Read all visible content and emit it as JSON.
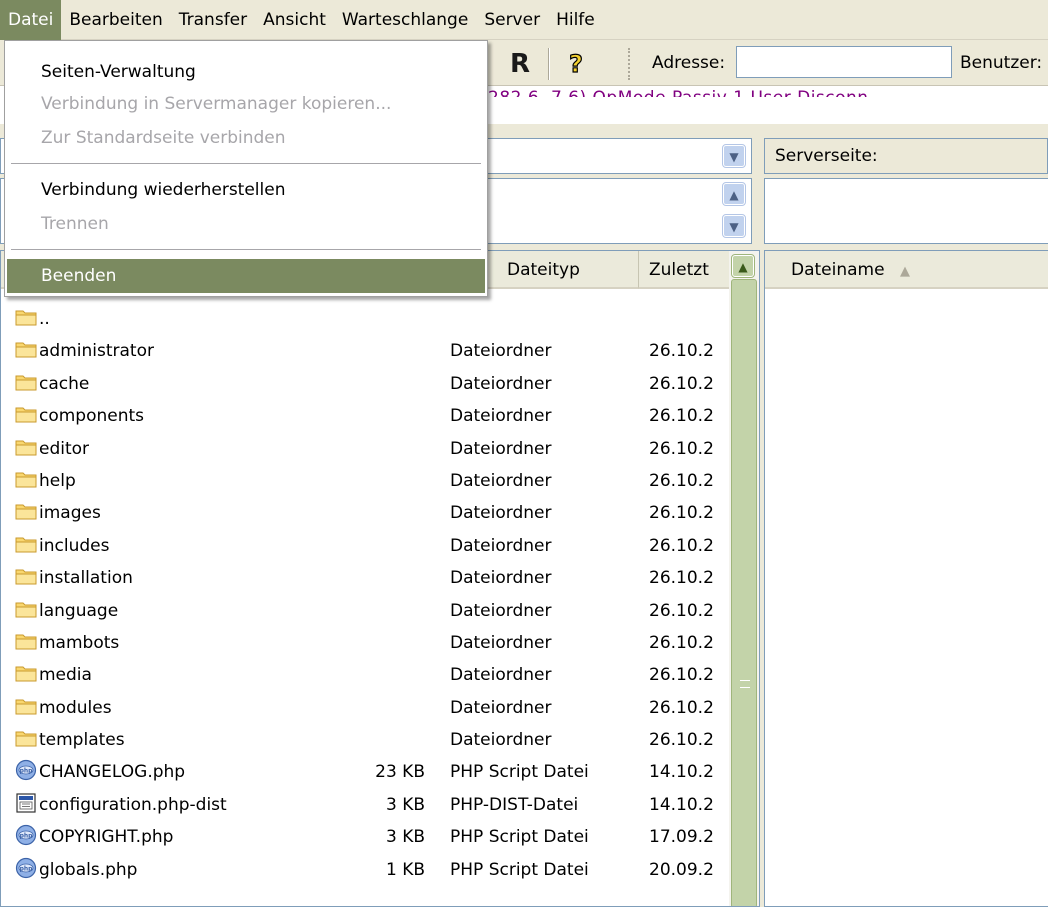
{
  "menubar": {
    "items": [
      "Datei",
      "Bearbeiten",
      "Transfer",
      "Ansicht",
      "Warteschlange",
      "Server",
      "Hilfe"
    ]
  },
  "toolbar": {
    "buttons": [
      "R"
    ],
    "address_label": "Adresse:",
    "address_value": "",
    "user_label": "Benutzer:"
  },
  "message_log": {
    "partial_line": "282,6, 7,6) OpMode  Passiv  1 User  Disconn  "
  },
  "file_menu": {
    "items": [
      {
        "label": "Seiten-Verwaltung",
        "enabled": true
      },
      {
        "label": "Verbindung in Servermanager kopieren...",
        "enabled": false
      },
      {
        "label": "Zur Standardseite verbinden",
        "enabled": false
      },
      {
        "label": "Verbindung wiederherstellen",
        "enabled": true
      },
      {
        "label": "Trennen",
        "enabled": false
      },
      {
        "label": "Beenden",
        "enabled": true,
        "highlighted": true
      }
    ]
  },
  "local_panel": {
    "columns": {
      "filetype": "Dateityp",
      "modified": "Zuletzt"
    },
    "rows": [
      {
        "name": "..",
        "size": "",
        "type": "",
        "date": "",
        "icon": "folder-icon"
      },
      {
        "name": "administrator",
        "size": "",
        "type": "Dateiordner",
        "date": "26.10.2",
        "icon": "folder-icon"
      },
      {
        "name": "cache",
        "size": "",
        "type": "Dateiordner",
        "date": "26.10.2",
        "icon": "folder-icon"
      },
      {
        "name": "components",
        "size": "",
        "type": "Dateiordner",
        "date": "26.10.2",
        "icon": "folder-icon"
      },
      {
        "name": "editor",
        "size": "",
        "type": "Dateiordner",
        "date": "26.10.2",
        "icon": "folder-icon"
      },
      {
        "name": "help",
        "size": "",
        "type": "Dateiordner",
        "date": "26.10.2",
        "icon": "folder-icon"
      },
      {
        "name": "images",
        "size": "",
        "type": "Dateiordner",
        "date": "26.10.2",
        "icon": "folder-icon"
      },
      {
        "name": "includes",
        "size": "",
        "type": "Dateiordner",
        "date": "26.10.2",
        "icon": "folder-icon"
      },
      {
        "name": "installation",
        "size": "",
        "type": "Dateiordner",
        "date": "26.10.2",
        "icon": "folder-icon"
      },
      {
        "name": "language",
        "size": "",
        "type": "Dateiordner",
        "date": "26.10.2",
        "icon": "folder-icon"
      },
      {
        "name": "mambots",
        "size": "",
        "type": "Dateiordner",
        "date": "26.10.2",
        "icon": "folder-icon"
      },
      {
        "name": "media",
        "size": "",
        "type": "Dateiordner",
        "date": "26.10.2",
        "icon": "folder-icon"
      },
      {
        "name": "modules",
        "size": "",
        "type": "Dateiordner",
        "date": "26.10.2",
        "icon": "folder-icon"
      },
      {
        "name": "templates",
        "size": "",
        "type": "Dateiordner",
        "date": "26.10.2",
        "icon": "folder-icon"
      },
      {
        "name": "CHANGELOG.php",
        "size": "23 KB",
        "type": "PHP Script Datei",
        "date": "14.10.2",
        "icon": "php-file-icon"
      },
      {
        "name": "configuration.php-dist",
        "size": "3 KB",
        "type": "PHP-DIST-Datei",
        "date": "14.10.2",
        "icon": "generic-file-icon"
      },
      {
        "name": "COPYRIGHT.php",
        "size": "3 KB",
        "type": "PHP Script Datei",
        "date": "17.09.2",
        "icon": "php-file-icon"
      },
      {
        "name": "globals.php",
        "size": "1 KB",
        "type": "PHP Script Datei",
        "date": "20.09.2",
        "icon": "php-file-icon"
      }
    ]
  },
  "remote_panel": {
    "label": "Serverseite:",
    "columns": {
      "filename": "Dateiname"
    }
  },
  "colors": {
    "menu_highlight": "#7b8a60",
    "disabled_text": "#a7a6aa",
    "log_text": "#800080"
  }
}
